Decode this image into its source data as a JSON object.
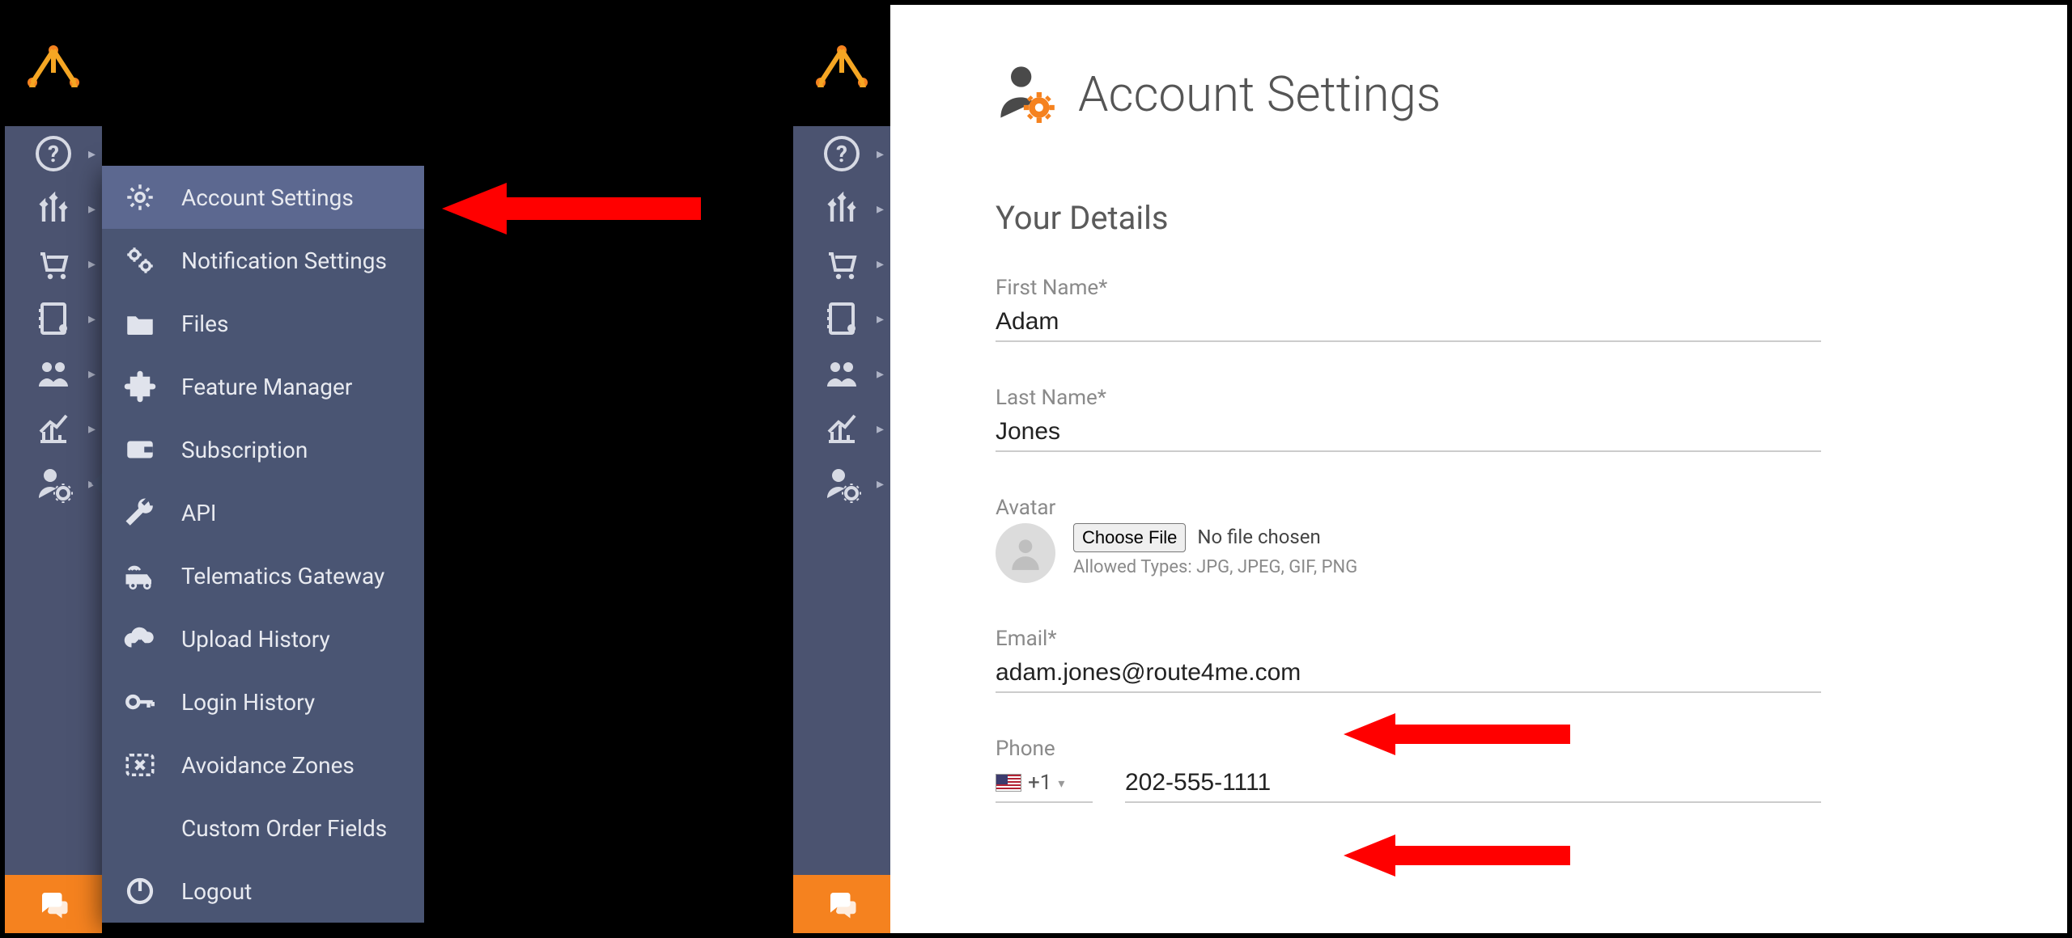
{
  "flyout": {
    "items": [
      {
        "label": "Account Settings"
      },
      {
        "label": "Notification Settings"
      },
      {
        "label": "Files"
      },
      {
        "label": "Feature Manager"
      },
      {
        "label": "Subscription"
      },
      {
        "label": "API"
      },
      {
        "label": "Telematics Gateway"
      },
      {
        "label": "Upload History"
      },
      {
        "label": "Login History"
      },
      {
        "label": "Avoidance Zones"
      },
      {
        "label": "Custom Order Fields"
      },
      {
        "label": "Logout"
      }
    ]
  },
  "page": {
    "title": "Account Settings",
    "section_heading": "Your Details",
    "first_name_label": "First Name*",
    "first_name_value": "Adam",
    "last_name_label": "Last Name*",
    "last_name_value": "Jones",
    "avatar_label": "Avatar",
    "choose_file_label": "Choose File",
    "no_file_text": "No file chosen",
    "allowed_types": "Allowed Types: JPG, JPEG, GIF, PNG",
    "email_label": "Email*",
    "email_value": "adam.jones@route4me.com",
    "phone_label": "Phone",
    "phone_cc": "+1",
    "phone_value": "202-555-1111"
  }
}
